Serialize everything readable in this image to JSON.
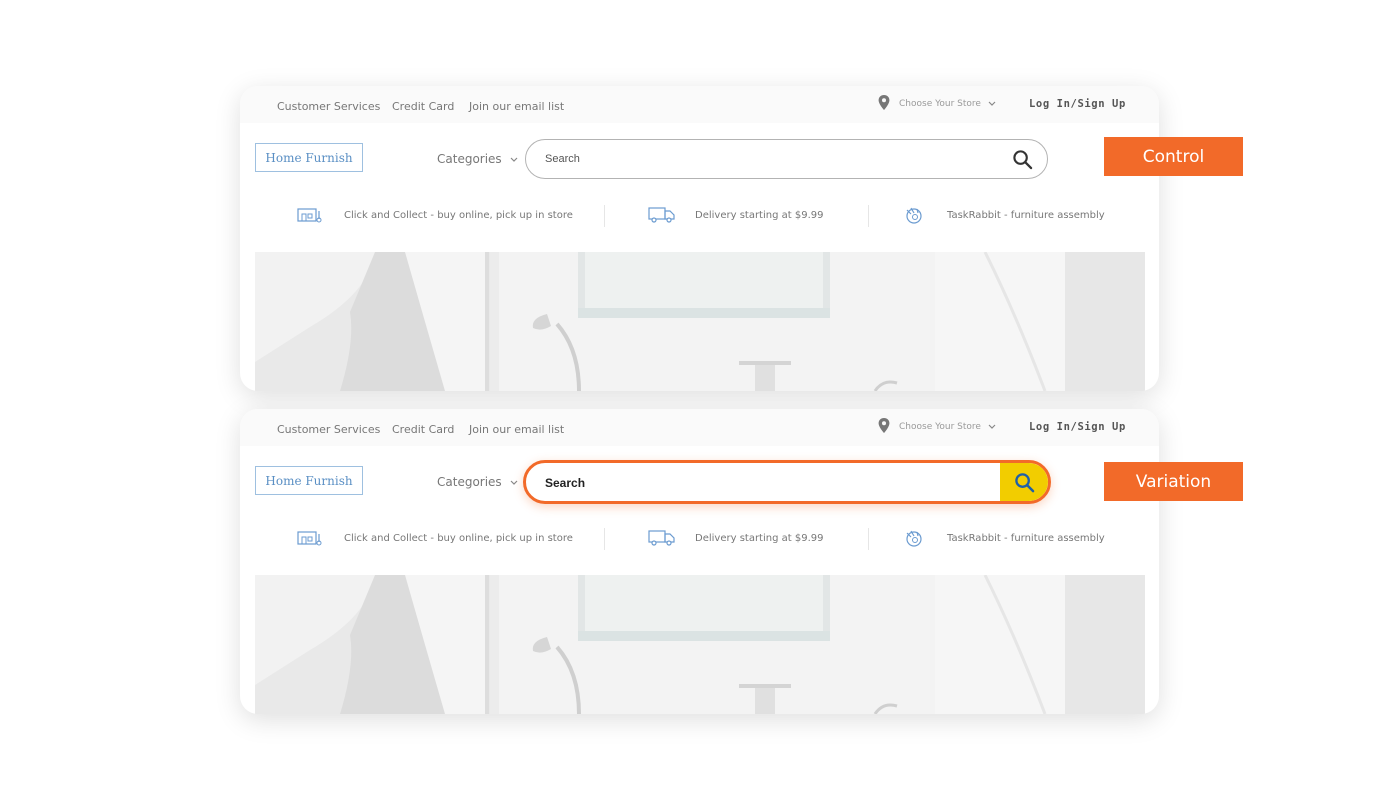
{
  "utility_links": [
    "Customer Services",
    "Credit Card",
    "Join our email list"
  ],
  "store_label": "Choose Your Store",
  "login_label": "Log In/Sign Up",
  "logo_text": "Home Furnish",
  "categories_label": "Categories",
  "search_placeholder": "Search",
  "perks": [
    {
      "icon": "store-icon",
      "text": "Click and Collect - buy online, pick up in store"
    },
    {
      "icon": "truck-icon",
      "text": "Delivery starting at $9.99"
    },
    {
      "icon": "taskrabbit-icon",
      "text": "TaskRabbit - furniture assembly"
    }
  ],
  "labels": {
    "control": "Control",
    "variation": "Variation"
  },
  "colors": {
    "accent": "#f26a29",
    "search_button": "#f2cd00",
    "logo": "#5a8fc4"
  }
}
